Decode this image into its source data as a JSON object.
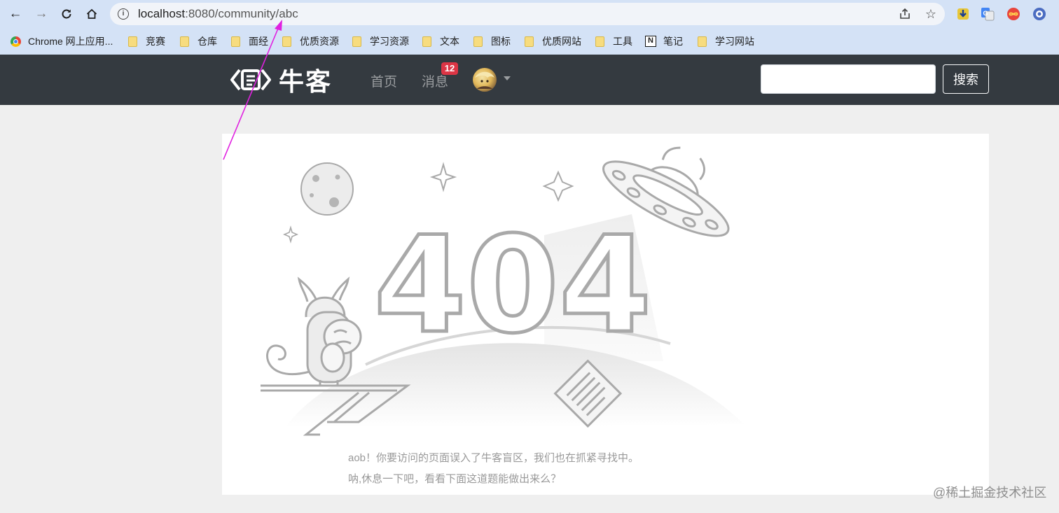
{
  "browser": {
    "url_host": "localhost",
    "url_path": ":8080/community/abc",
    "bookmarks": [
      {
        "label": "Chrome 网上应用..."
      },
      {
        "label": "竞赛"
      },
      {
        "label": "仓库"
      },
      {
        "label": "面经"
      },
      {
        "label": "优质资源"
      },
      {
        "label": "学习资源"
      },
      {
        "label": "文本"
      },
      {
        "label": "图标"
      },
      {
        "label": "优质网站"
      },
      {
        "label": "工具"
      },
      {
        "label": "笔记"
      },
      {
        "label": "学习网站"
      }
    ]
  },
  "site": {
    "logo_text": "牛客",
    "nav": {
      "home": "首页",
      "messages": "消息",
      "message_count": "12"
    },
    "search": {
      "placeholder": "",
      "button": "搜索"
    },
    "not_found": {
      "code": "404",
      "message_line1": "aob！你要访问的页面误入了牛客盲区，我们也在抓紧寻找中。",
      "message_line2": "呐,休息一下吧，看看下面这道题能做出来么？"
    }
  },
  "watermark": "@稀土掘金技术社区",
  "colors": {
    "navbar": "#343a40",
    "badge": "#dc3545",
    "annotation_arrow": "#e020e0",
    "illustration": "#b3b3b3"
  }
}
